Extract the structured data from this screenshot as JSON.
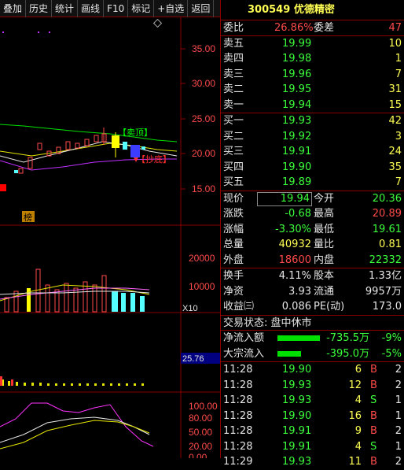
{
  "toolbar": {
    "buttons": [
      "叠加",
      "历史",
      "统计",
      "画线",
      "F10",
      "标记",
      "+自选",
      "返回"
    ],
    "corner_icon": "diamond-icon"
  },
  "chart": {
    "price_axis": [
      "35.00",
      "30.00",
      "25.00",
      "20.00",
      "15.00"
    ],
    "sell_top_label": "【卖顶】",
    "buy_bottom_label": "【抄底】",
    "left_badge": "榜",
    "volume_axis": [
      "20000",
      "10000"
    ],
    "volume_unit": "X10",
    "indicator_value": "25.76",
    "kdj_axis": [
      "100.00",
      "80.00",
      "50.00",
      "20.00",
      "0.00"
    ]
  },
  "quote": {
    "code": "300549",
    "name": "优德精密",
    "ratio_label": "委比",
    "ratio_value": "26.86%",
    "diff_label": "委差",
    "diff_value": "47",
    "asks": [
      {
        "label": "卖五",
        "price": "19.99",
        "vol": "10"
      },
      {
        "label": "卖四",
        "price": "19.98",
        "vol": "1"
      },
      {
        "label": "卖三",
        "price": "19.96",
        "vol": "7"
      },
      {
        "label": "卖二",
        "price": "19.95",
        "vol": "31"
      },
      {
        "label": "卖一",
        "price": "19.94",
        "vol": "15"
      }
    ],
    "bids": [
      {
        "label": "买一",
        "price": "19.93",
        "vol": "42"
      },
      {
        "label": "买二",
        "price": "19.92",
        "vol": "3"
      },
      {
        "label": "买三",
        "price": "19.91",
        "vol": "24"
      },
      {
        "label": "买四",
        "price": "19.90",
        "vol": "35"
      },
      {
        "label": "买五",
        "price": "19.89",
        "vol": "7"
      }
    ],
    "stats": [
      {
        "l1": "现价",
        "v1": "19.94",
        "l2": "今开",
        "v2": "20.36"
      },
      {
        "l1": "涨跌",
        "v1": "-0.68",
        "l2": "最高",
        "v2": "20.89"
      },
      {
        "l1": "涨幅",
        "v1": "-3.30%",
        "l2": "最低",
        "v2": "19.61"
      },
      {
        "l1": "总量",
        "v1": "40932",
        "l2": "量比",
        "v2": "0.81"
      },
      {
        "l1": "外盘",
        "v1": "18600",
        "l2": "内盘",
        "v2": "22332"
      }
    ],
    "stats2": [
      {
        "l1": "换手",
        "v1": "4.11%",
        "l2": "股本",
        "v2": "1.33亿"
      },
      {
        "l1": "净资",
        "v1": "3.93",
        "l2": "流通",
        "v2": "9957万"
      },
      {
        "l1": "收益㈢",
        "v1": "0.086",
        "l2": "PE(动)",
        "v2": "173.0"
      }
    ],
    "trade_status": "交易状态: 盘中休市",
    "flows": [
      {
        "label": "净流入额",
        "value": "-735.5万",
        "pct": "-9%",
        "fill": 0.9
      },
      {
        "label": "大宗流入",
        "value": "-395.0万",
        "pct": "-5%",
        "fill": 0.5
      }
    ],
    "ticks": [
      {
        "time": "11:28",
        "price": "19.90",
        "vol": "6",
        "side": "B",
        "n": "2"
      },
      {
        "time": "11:28",
        "price": "19.93",
        "vol": "12",
        "side": "B",
        "n": "2"
      },
      {
        "time": "11:28",
        "price": "19.93",
        "vol": "4",
        "side": "S",
        "n": "1"
      },
      {
        "time": "11:28",
        "price": "19.90",
        "vol": "16",
        "side": "B",
        "n": "1"
      },
      {
        "time": "11:28",
        "price": "19.91",
        "vol": "9",
        "side": "B",
        "n": "2"
      },
      {
        "time": "11:28",
        "price": "19.91",
        "vol": "4",
        "side": "S",
        "n": "1"
      },
      {
        "time": "11:29",
        "price": "19.93",
        "vol": "11",
        "side": "B",
        "n": "2"
      }
    ]
  }
}
